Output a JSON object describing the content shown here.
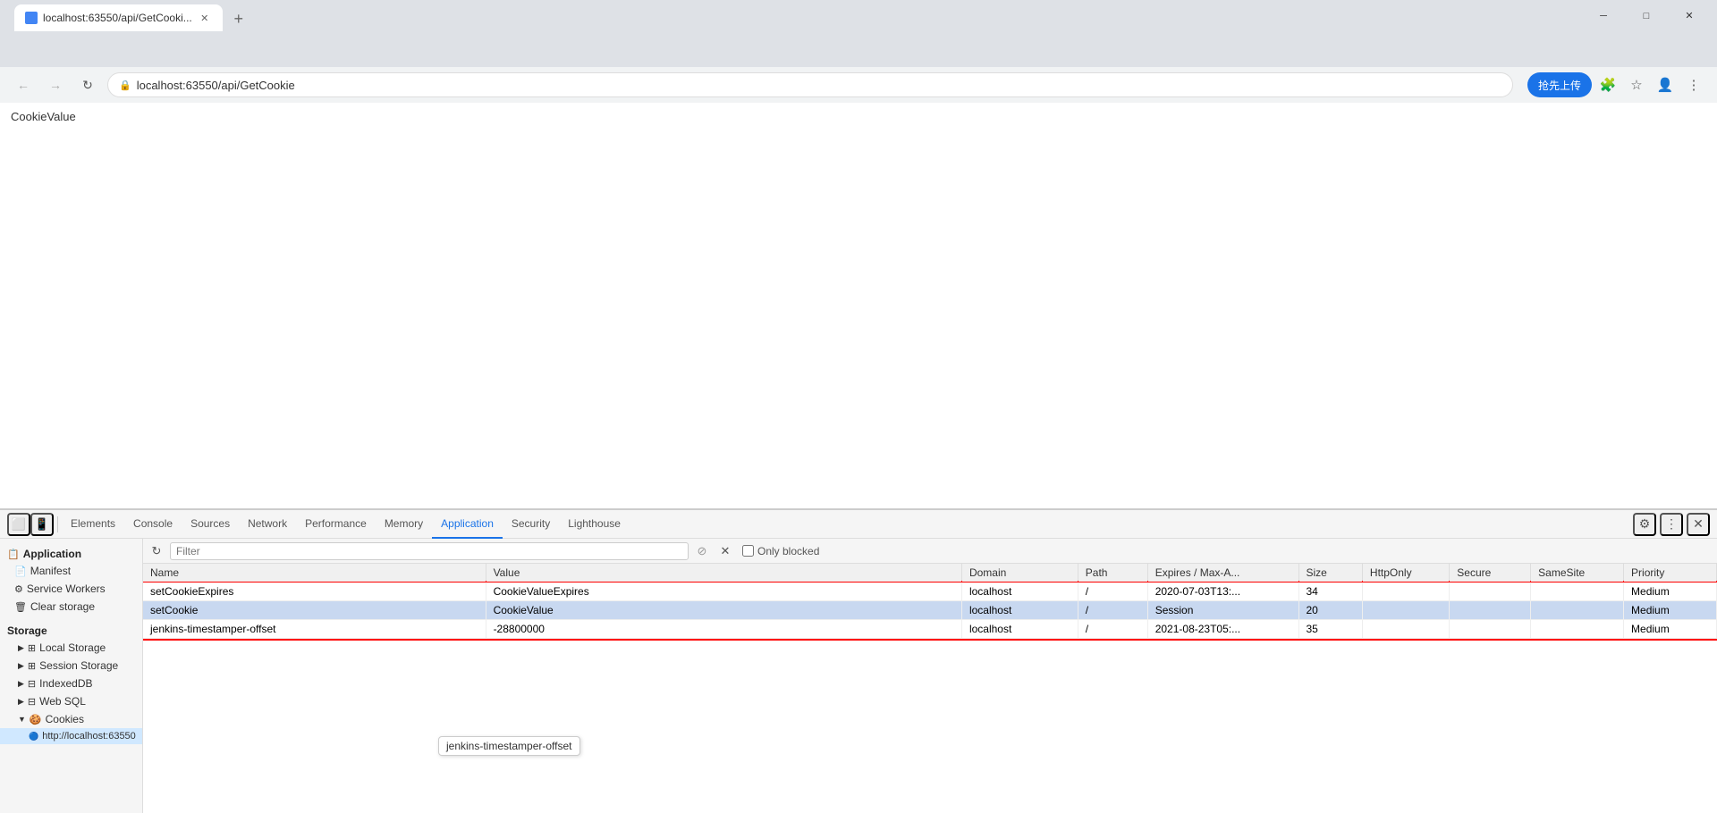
{
  "browser": {
    "tab_title": "localhost:63550/api/GetCooki...",
    "tab_favicon": "🔵",
    "url": "localhost:63550/api/GetCookie",
    "new_tab_label": "+",
    "extension_btn_label": "抢先上传",
    "nav": {
      "back": "←",
      "forward": "→",
      "refresh": "↻",
      "close": "✕",
      "minimize": "─",
      "maximize": "□"
    }
  },
  "page": {
    "body_text": "CookieValue"
  },
  "devtools": {
    "tabs": [
      {
        "id": "elements",
        "label": "Elements"
      },
      {
        "id": "console",
        "label": "Console"
      },
      {
        "id": "sources",
        "label": "Sources"
      },
      {
        "id": "network",
        "label": "Network"
      },
      {
        "id": "performance",
        "label": "Performance"
      },
      {
        "id": "memory",
        "label": "Memory"
      },
      {
        "id": "application",
        "label": "Application"
      },
      {
        "id": "security",
        "label": "Security"
      },
      {
        "id": "lighthouse",
        "label": "Lighthouse"
      }
    ],
    "active_tab": "application"
  },
  "sidebar": {
    "section_title": "Application",
    "items": [
      {
        "id": "manifest",
        "label": "Manifest",
        "icon": "📄"
      },
      {
        "id": "service-workers",
        "label": "Service Workers",
        "icon": "⚙"
      },
      {
        "id": "clear-storage",
        "label": "Clear storage",
        "icon": "🗑"
      }
    ],
    "storage_title": "Storage",
    "storage_items": [
      {
        "id": "local-storage",
        "label": "Local Storage",
        "icon": "▶",
        "has_children": true
      },
      {
        "id": "session-storage",
        "label": "Session Storage",
        "icon": "▶",
        "has_children": true
      },
      {
        "id": "indexeddb",
        "label": "IndexedDB",
        "icon": "▶",
        "has_children": false
      },
      {
        "id": "web-sql",
        "label": "Web SQL",
        "icon": "▶",
        "has_children": false
      },
      {
        "id": "cookies",
        "label": "Cookies",
        "icon": "▼",
        "has_children": true,
        "expanded": true
      }
    ],
    "cookies_child": "http://localhost:63550"
  },
  "cookies_panel": {
    "filter_placeholder": "Filter",
    "only_blocked_label": "Only blocked",
    "columns": [
      "Name",
      "Value",
      "Domain",
      "Path",
      "Expires / Max-A...",
      "Size",
      "HttpOnly",
      "Secure",
      "SameSite",
      "Priority"
    ],
    "rows": [
      {
        "name": "setCookieExpires",
        "value": "CookieValueExpires",
        "domain": "localhost",
        "path": "/",
        "expires": "2020-07-03T13:...",
        "size": "34",
        "httponly": "",
        "secure": "",
        "samesite": "",
        "priority": "Medium",
        "selected": false
      },
      {
        "name": "setCookie",
        "value": "CookieValue",
        "domain": "localhost",
        "path": "/",
        "expires": "Session",
        "size": "20",
        "httponly": "",
        "secure": "",
        "samesite": "",
        "priority": "Medium",
        "selected": true
      },
      {
        "name": "jenkins-timestamper-offset",
        "value": "-28800000",
        "domain": "localhost",
        "path": "/",
        "expires": "2021-08-23T05:...",
        "size": "35",
        "httponly": "",
        "secure": "",
        "samesite": "",
        "priority": "Medium",
        "selected": false
      }
    ],
    "tooltip_text": "jenkins-timestamper-offset"
  }
}
